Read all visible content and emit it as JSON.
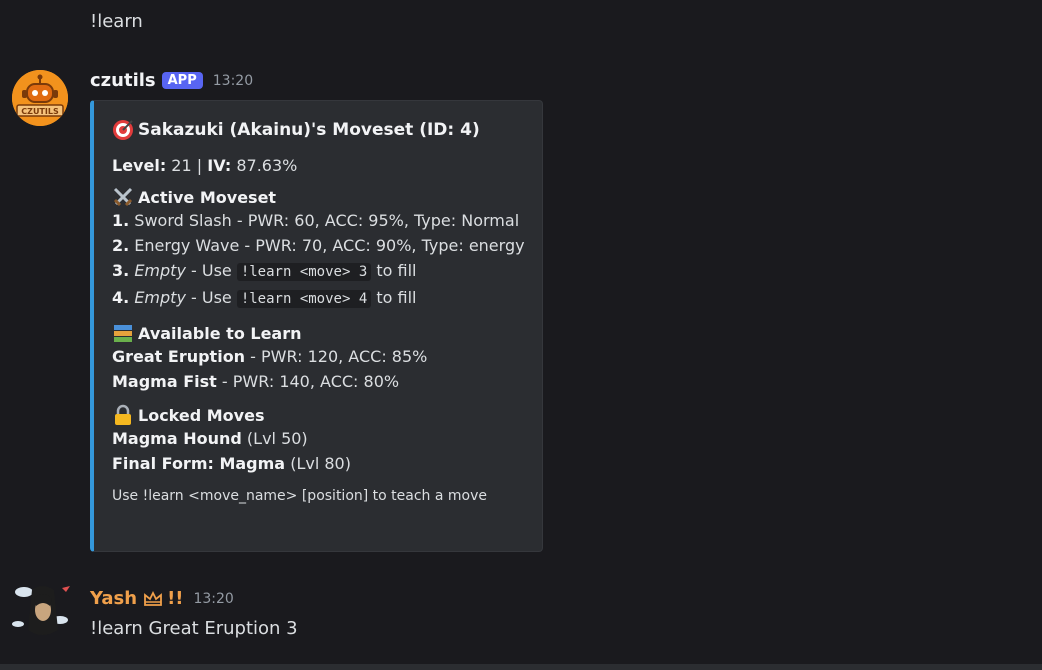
{
  "previous_message": {
    "text": "!learn"
  },
  "bot_message": {
    "username": "czutils",
    "badge": "APP",
    "timestamp": "13:20",
    "avatar_label": "CZUTILS",
    "embed": {
      "title": "Sakazuki (Akainu)'s Moveset (ID: 4)",
      "level_label": "Level:",
      "level_value": " 21 | ",
      "iv_label": "IV:",
      "iv_value": " 87.63%",
      "active_title": "Active Moveset",
      "moves": [
        {
          "num": "1.",
          "text": " Sword Slash - PWR: 60, ACC: 95%, Type: Normal"
        },
        {
          "num": "2.",
          "text": " Energy Wave - PWR: 70, ACC: 90%, Type: energy"
        },
        {
          "num": "3.",
          "empty": "Empty",
          "pre": " - Use ",
          "code": "!learn <move> 3",
          "post": " to fill"
        },
        {
          "num": "4.",
          "empty": "Empty",
          "pre": " - Use ",
          "code": "!learn <move> 4",
          "post": " to fill"
        }
      ],
      "available_title": "Available to Learn",
      "available": [
        {
          "name": "Great Eruption",
          "stats": " - PWR: 120, ACC: 85%"
        },
        {
          "name": "Magma Fist",
          "stats": " - PWR: 140, ACC: 80%"
        }
      ],
      "locked_title": "Locked Moves",
      "locked": [
        {
          "name": "Magma Hound",
          "lvl": " (Lvl 50)"
        },
        {
          "name": "Final Form: Magma",
          "lvl": " (Lvl 80)"
        }
      ],
      "footer": "Use !learn <move_name> [position] to teach a move"
    }
  },
  "user_message": {
    "username": "Yash",
    "suffix": "!!",
    "timestamp": "13:20",
    "text": "!learn Great Eruption 3"
  },
  "colors": {
    "background": "#1a1a1e",
    "embed_bg": "#2b2d31",
    "embed_border": "#3498db",
    "app_badge": "#5865f2",
    "bot_avatar": "#f2921d",
    "yash_name": "#f0a04b"
  }
}
